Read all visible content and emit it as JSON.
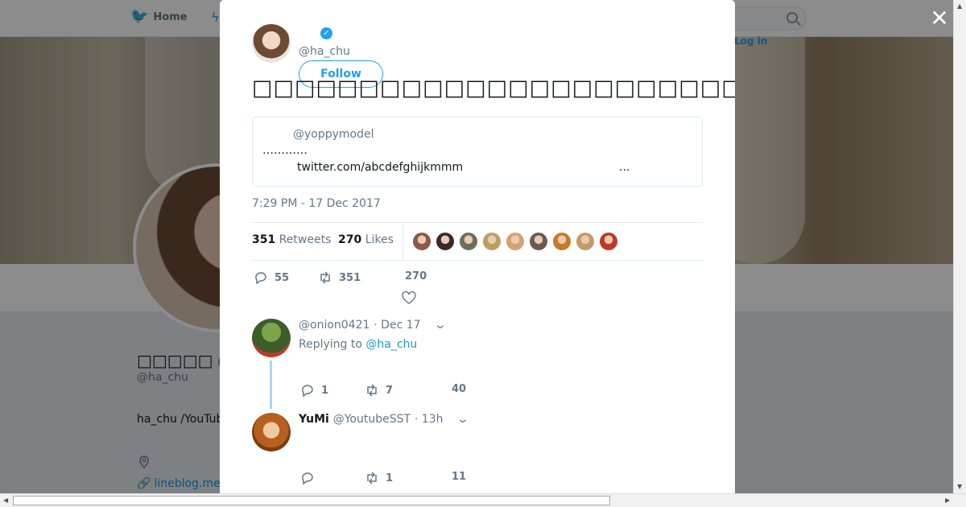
{
  "nav": {
    "home_label": "Home",
    "login_hint": "Log in"
  },
  "profile": {
    "name": "□□□□□",
    "handle": "@ha_chu",
    "bio": "ha_chu /YouTub",
    "link": "lineblog.me"
  },
  "modal": {
    "author_handle": "@ha_chu",
    "follow_label": "Follow",
    "tweet_text": "□□□□□□□□□□□□□□□□□□□□□□□□□□□□□□□□□□□□□□□□□□□□□□",
    "quote": {
      "handle": "@yoppymodel",
      "text": "…………",
      "link": "twitter.com/abcdefghijkmmm",
      "ellipsis": "..."
    },
    "timestamp": "7:29 PM - 17 Dec 2017",
    "stats": {
      "retweets_count": "351",
      "retweets_label": "Retweets",
      "likes_count": "270",
      "likes_label": "Likes"
    },
    "likers_colors": [
      "#8a5a4a",
      "#3a2a2a",
      "#6e6e5a",
      "#b9a060",
      "#d8a070",
      "#6a5a55",
      "#c7792b",
      "#c49a6a",
      "#c0392b"
    ],
    "actions": {
      "replies": "55",
      "retweets": "351",
      "likes": "270"
    }
  },
  "replies": [
    {
      "name": "",
      "handle": "@onion0421",
      "date": "· Dec 17",
      "replying_prefix": "Replying to",
      "replying_to": "@ha_chu",
      "avatar_color": "#4e7a3a",
      "replies": "1",
      "retweets": "7",
      "likes": "40"
    },
    {
      "name": "YuMi",
      "handle": "@YoutubeSST",
      "date": "· 13h",
      "avatar_color": "#b5601f",
      "replies": "",
      "retweets": "1",
      "likes": "11"
    }
  ]
}
